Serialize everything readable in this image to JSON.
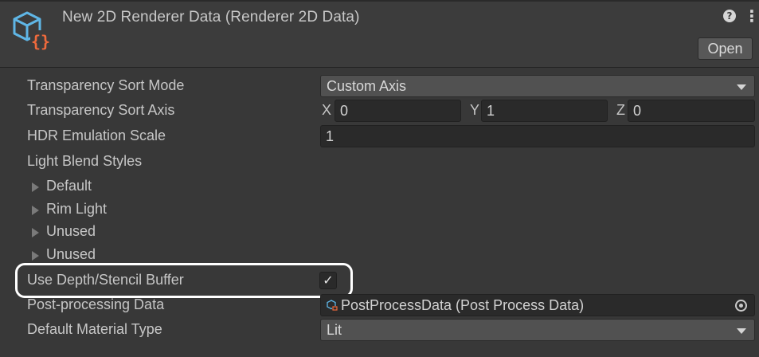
{
  "header": {
    "title": "New 2D Renderer Data (Renderer 2D Data)",
    "help_icon": "?",
    "menu_icon": "⋮",
    "open_label": "Open",
    "asset_icon": "renderer-data-asset-icon",
    "asset_icon_braces": "{}"
  },
  "properties": {
    "transparency_sort_mode": {
      "label": "Transparency Sort Mode",
      "value": "Custom Axis"
    },
    "transparency_sort_axis": {
      "label": "Transparency Sort Axis",
      "x_label": "X",
      "x_value": "0",
      "y_label": "Y",
      "y_value": "1",
      "z_label": "Z",
      "z_value": "0"
    },
    "hdr_emulation_scale": {
      "label": "HDR Emulation Scale",
      "value": "1"
    },
    "light_blend_styles": {
      "label": "Light Blend Styles",
      "items": [
        {
          "label": "Default"
        },
        {
          "label": "Rim Light"
        },
        {
          "label": "Unused"
        },
        {
          "label": "Unused"
        }
      ]
    },
    "use_depth_stencil_buffer": {
      "label": "Use Depth/Stencil Buffer",
      "checked": true,
      "check_glyph": "✓"
    },
    "post_processing_data": {
      "label": "Post-processing Data",
      "value": "PostProcessData (Post Process Data)"
    },
    "default_material_type": {
      "label": "Default Material Type",
      "value": "Lit"
    }
  },
  "colors": {
    "background": "#383838",
    "header_background": "#3c3c3c",
    "field_background": "#2a2a2a",
    "dropdown_background": "#515151",
    "icon_blue": "#5fb6e6",
    "icon_orange": "#f06a3c",
    "highlight_outline": "#ffffff"
  }
}
